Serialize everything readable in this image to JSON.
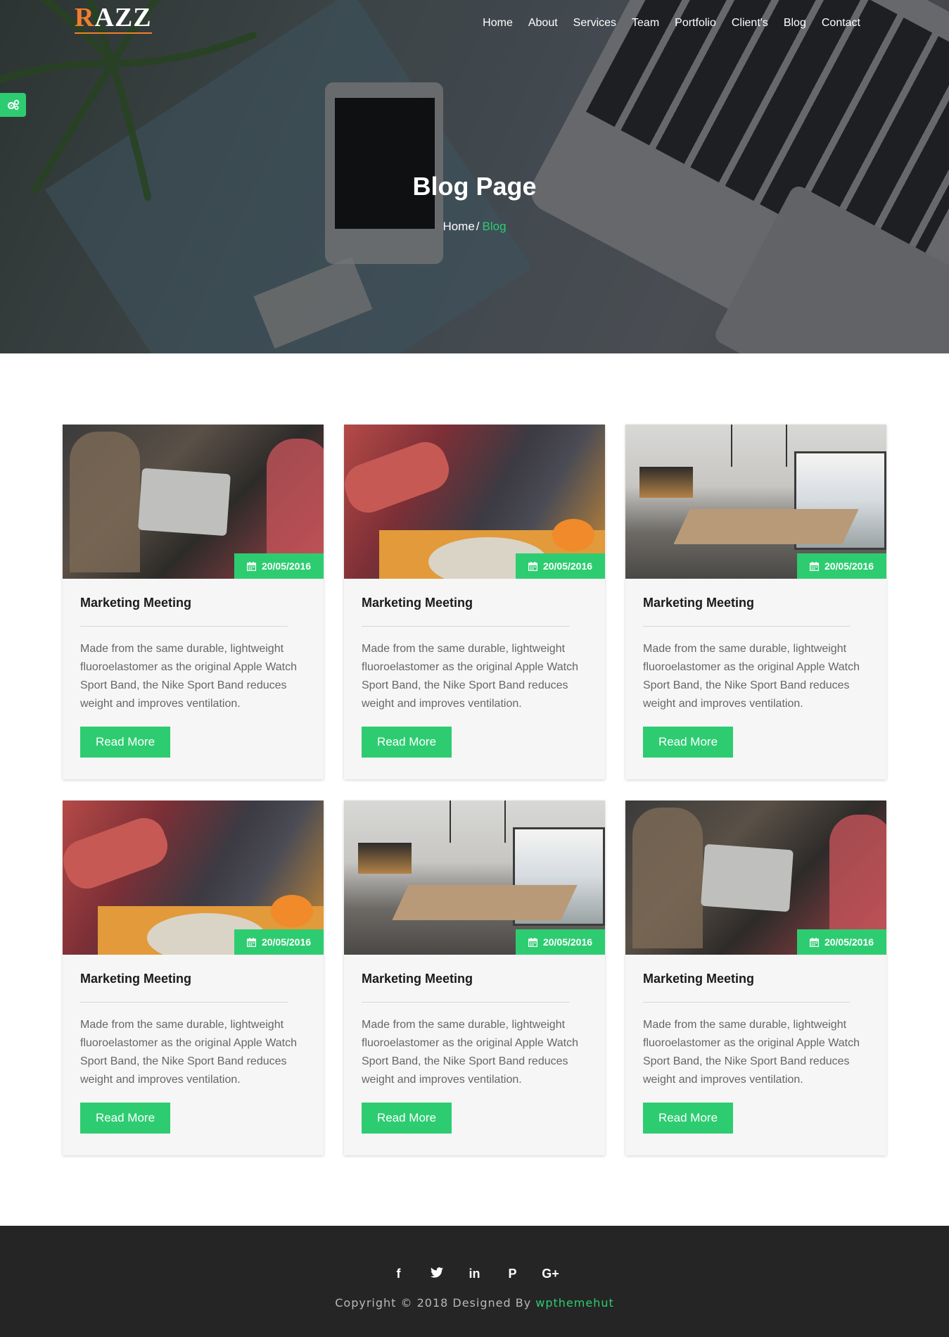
{
  "header": {
    "logo_first_letter": "R",
    "logo_rest": "AZZ",
    "nav": [
      "Home",
      "About",
      "Services",
      "Team",
      "Portfolio",
      "Client's",
      "Blog",
      "Contact"
    ]
  },
  "hero": {
    "title": "Blog Page",
    "breadcrumb_home": "Home",
    "breadcrumb_sep": "/",
    "breadcrumb_current": "Blog"
  },
  "posts": [
    {
      "date": "20/05/2016",
      "title": "Marketing Meeting",
      "excerpt": "Made from the same durable, lightweight fluoroelastomer as the original Apple Watch Sport Band, the Nike Sport Band reduces weight and improves ventilation.",
      "button": "Read More"
    },
    {
      "date": "20/05/2016",
      "title": "Marketing Meeting",
      "excerpt": "Made from the same durable, lightweight fluoroelastomer as the original Apple Watch Sport Band, the Nike Sport Band reduces weight and improves ventilation.",
      "button": "Read More"
    },
    {
      "date": "20/05/2016",
      "title": "Marketing Meeting",
      "excerpt": "Made from the same durable, lightweight fluoroelastomer as the original Apple Watch Sport Band, the Nike Sport Band reduces weight and improves ventilation.",
      "button": "Read More"
    },
    {
      "date": "20/05/2016",
      "title": "Marketing Meeting",
      "excerpt": "Made from the same durable, lightweight fluoroelastomer as the original Apple Watch Sport Band, the Nike Sport Band reduces weight and improves ventilation.",
      "button": "Read More"
    },
    {
      "date": "20/05/2016",
      "title": "Marketing Meeting",
      "excerpt": "Made from the same durable, lightweight fluoroelastomer as the original Apple Watch Sport Band, the Nike Sport Band reduces weight and improves ventilation.",
      "button": "Read More"
    },
    {
      "date": "20/05/2016",
      "title": "Marketing Meeting",
      "excerpt": "Made from the same durable, lightweight fluoroelastomer as the original Apple Watch Sport Band, the Nike Sport Band reduces weight and improves ventilation.",
      "button": "Read More"
    }
  ],
  "footer": {
    "social": [
      {
        "icon": "facebook-icon",
        "glyph": "f"
      },
      {
        "icon": "twitter-icon",
        "glyph": "❦"
      },
      {
        "icon": "linkedin-icon",
        "glyph": "in"
      },
      {
        "icon": "pinterest-icon",
        "glyph": "P"
      },
      {
        "icon": "google-plus-icon",
        "glyph": "G+"
      }
    ],
    "copyright_text": "Copyright © 2018 Designed By",
    "brand": "wpthemehut"
  },
  "colors": {
    "accent": "#2ecc71",
    "logo_orange": "#f07f2a",
    "footer_bg": "#252525"
  }
}
